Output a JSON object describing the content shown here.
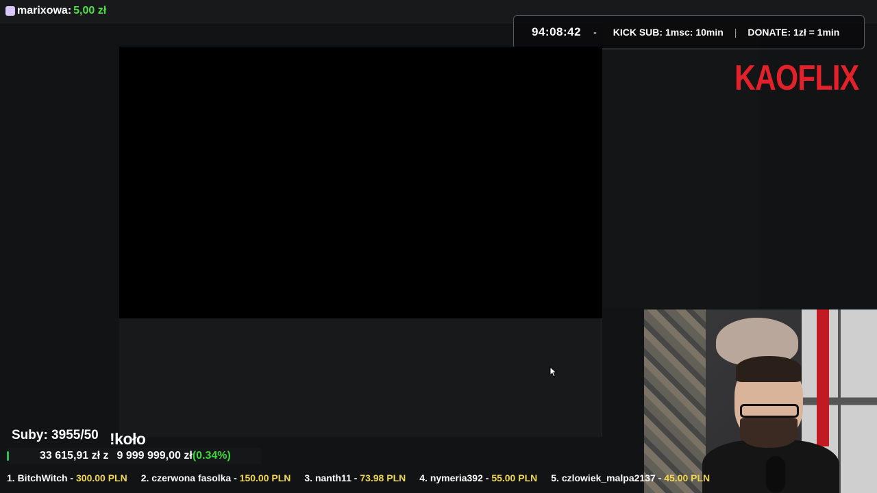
{
  "top_alert": {
    "name": "marixowa:",
    "amount": "5,00 zł"
  },
  "timer": {
    "time": "94:08:42",
    "separator": "-",
    "kick_sub": "KICK SUB: 1msc: 10min",
    "divider": "|",
    "donate": "DONATE: 1zł = 1min"
  },
  "logo": "KAOFLIX",
  "subs": "Suby: 3955/50",
  "kolo": "!koło",
  "goal": {
    "current": "33 615,91 zł z",
    "target": "9 999 999,00 zł",
    "percent": "(0.34%)",
    "progress": 0.0034
  },
  "ranking": [
    {
      "label": "1. BitchWitch -",
      "value": "300.00 PLN"
    },
    {
      "label": "2. czerwona fasolka -",
      "value": "150.00 PLN"
    },
    {
      "label": "3. nanth11 -",
      "value": "73.98 PLN"
    },
    {
      "label": "4. nymeria392 -",
      "value": "55.00 PLN"
    },
    {
      "label": "5. czlowiek_malpa2137 -",
      "value": "45.00 PLN"
    }
  ]
}
